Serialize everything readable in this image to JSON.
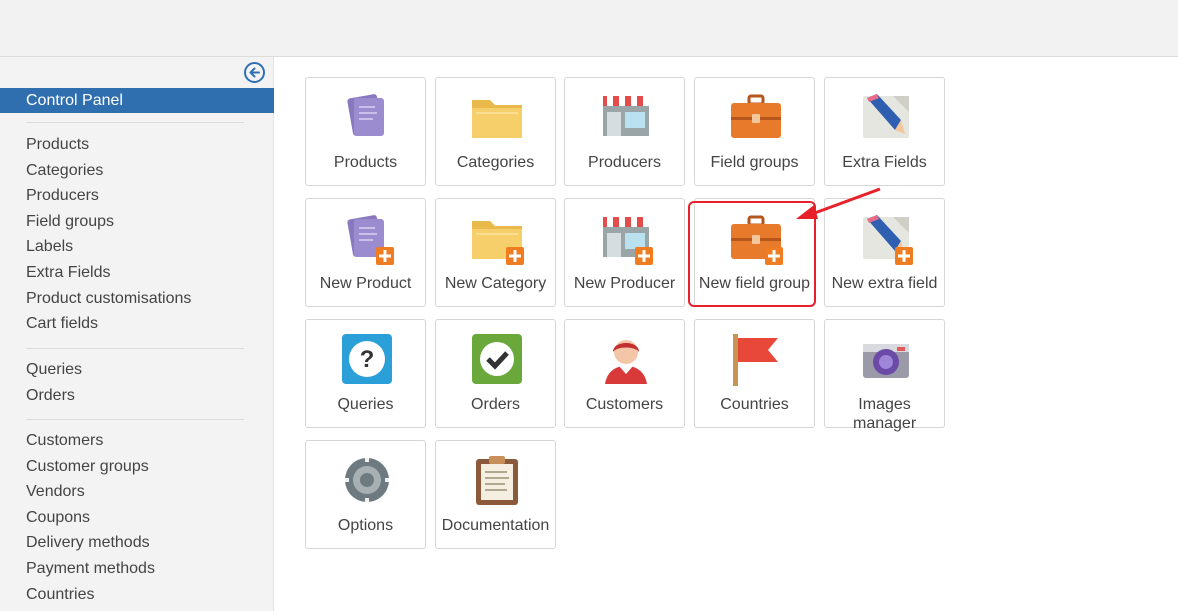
{
  "sidebar": {
    "collapse_icon": "arrow-left-circle-icon",
    "control_panel": "Control Panel",
    "group1": [
      "Products",
      "Categories",
      "Producers",
      "Field groups",
      "Labels",
      "Extra Fields",
      "Product customisations",
      "Cart fields"
    ],
    "group2": [
      "Queries",
      "Orders"
    ],
    "group3": [
      "Customers",
      "Customer groups",
      "Vendors",
      "Coupons",
      "Delivery methods",
      "Payment methods",
      "Countries"
    ]
  },
  "tiles": [
    {
      "label": "Products",
      "icon": "products-icon"
    },
    {
      "label": "Categories",
      "icon": "folder-icon"
    },
    {
      "label": "Producers",
      "icon": "shop-icon"
    },
    {
      "label": "Field groups",
      "icon": "briefcase-icon"
    },
    {
      "label": "Extra Fields",
      "icon": "pencil-icon"
    },
    {
      "label": "New Product",
      "icon": "new-product-icon"
    },
    {
      "label": "New Category",
      "icon": "new-folder-icon"
    },
    {
      "label": "New Producer",
      "icon": "new-shop-icon"
    },
    {
      "label": "New field group",
      "icon": "new-briefcase-icon"
    },
    {
      "label": "New extra field",
      "icon": "new-pencil-icon"
    },
    {
      "label": "Queries",
      "icon": "question-icon"
    },
    {
      "label": "Orders",
      "icon": "checkmark-icon"
    },
    {
      "label": "Customers",
      "icon": "customer-icon"
    },
    {
      "label": "Countries",
      "icon": "flag-icon"
    },
    {
      "label": "Images manager",
      "icon": "camera-icon"
    },
    {
      "label": "Options",
      "icon": "gear-icon"
    },
    {
      "label": "Documentation",
      "icon": "clipboard-icon"
    }
  ],
  "colors": {
    "accent": "#2f6fb0",
    "highlight": "#e8202a",
    "plus_badge": "#f07c22"
  }
}
